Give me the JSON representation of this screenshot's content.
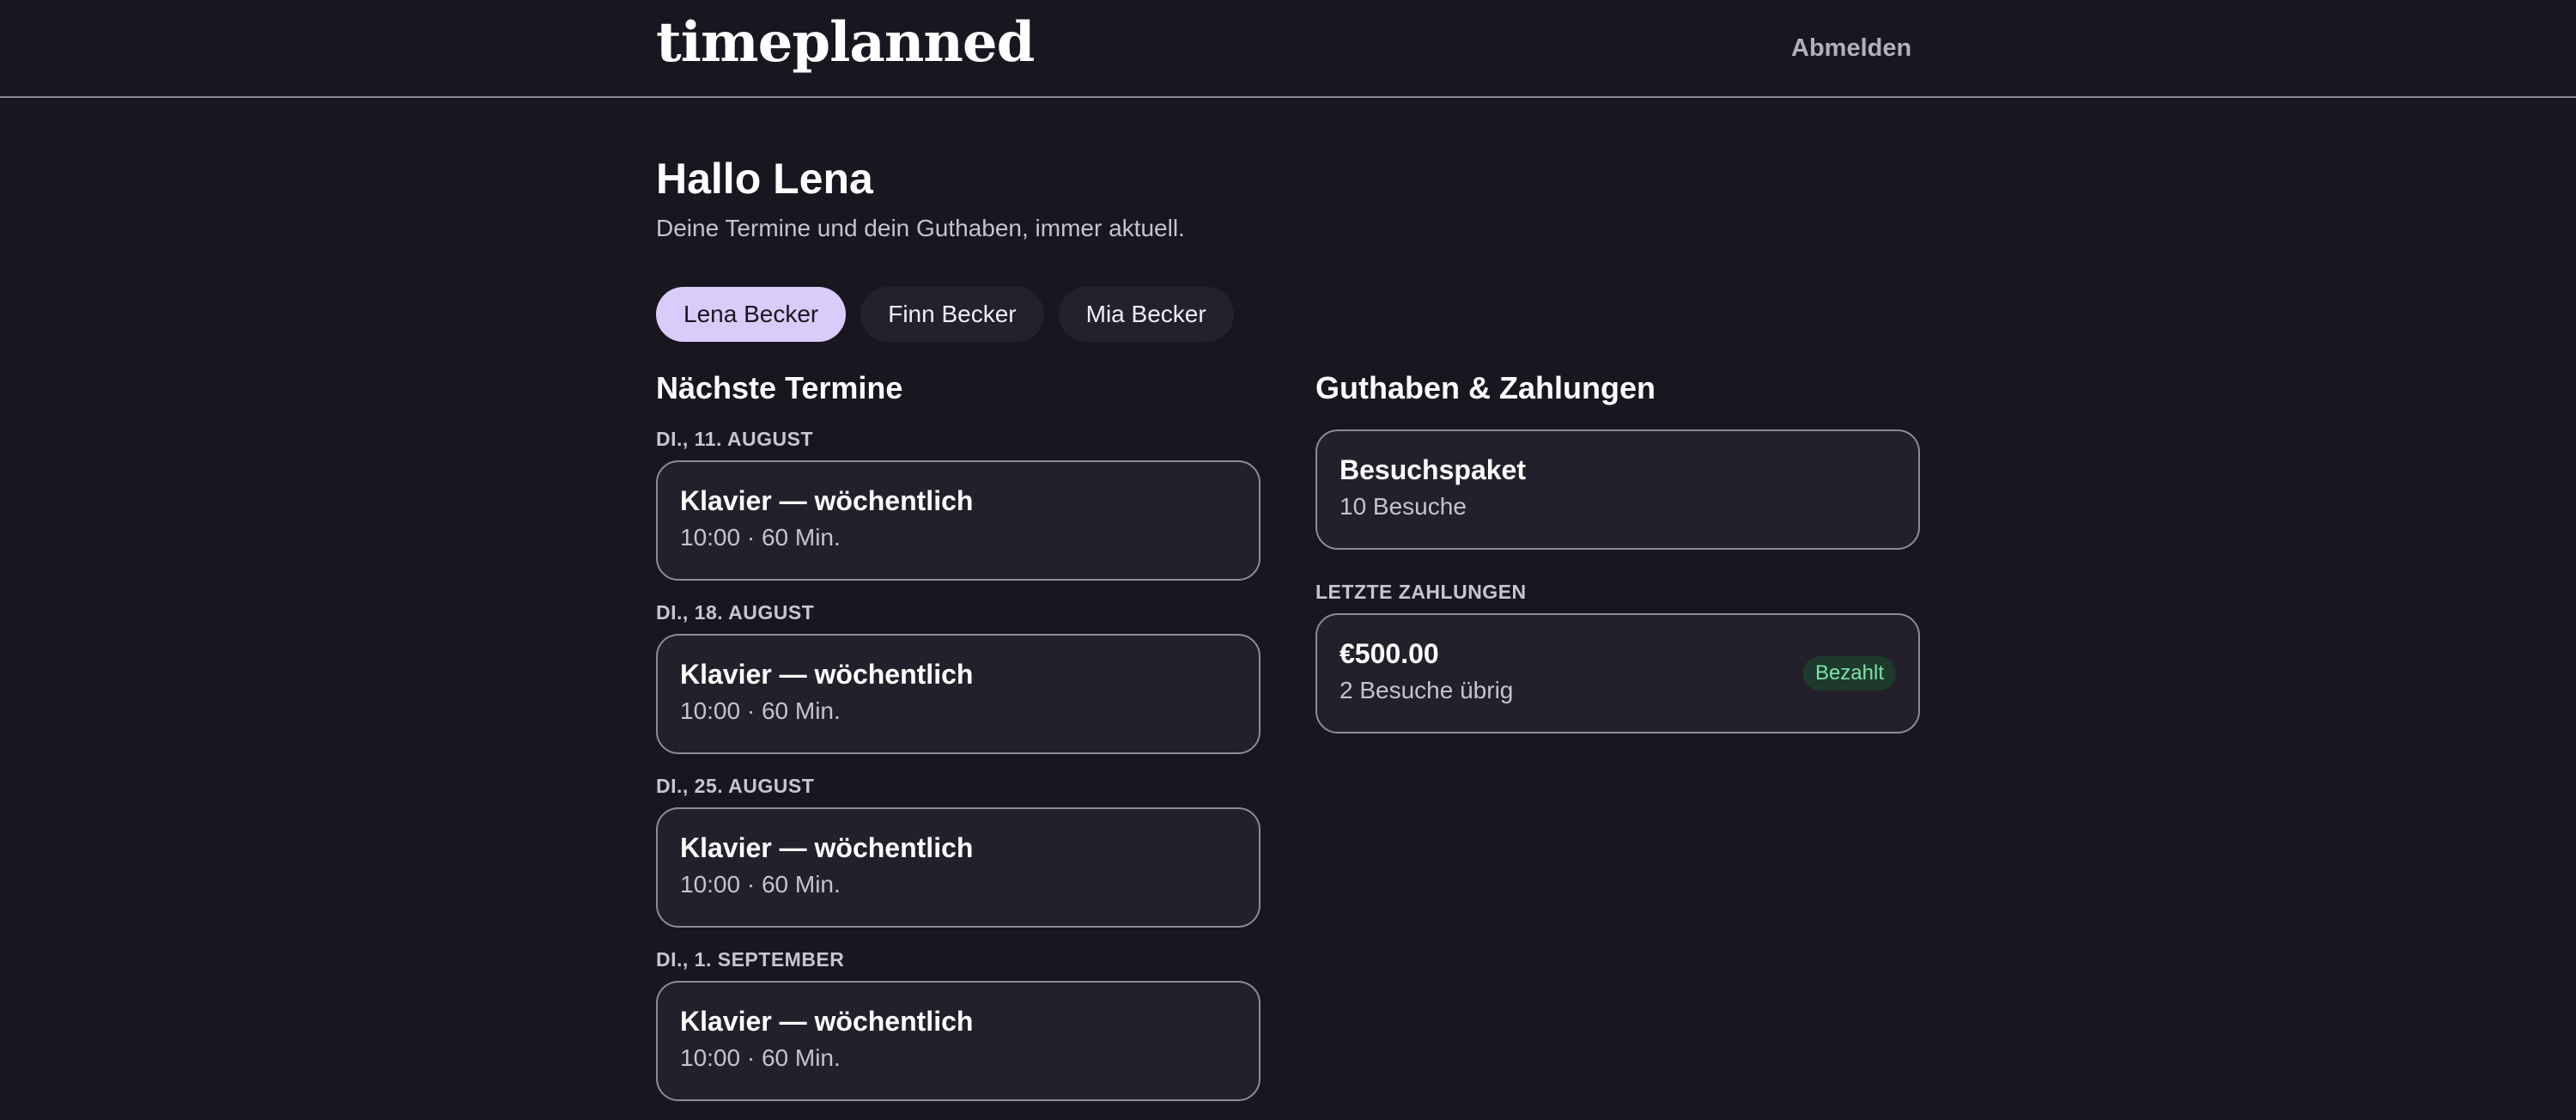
{
  "header": {
    "logo": "timeplanned",
    "logout_label": "Abmelden"
  },
  "greeting": "Hallo Lena",
  "subtitle": "Deine Termine und dein Guthaben, immer aktuell.",
  "person_tabs": [
    {
      "label": "Lena Becker",
      "active": true
    },
    {
      "label": "Finn Becker",
      "active": false
    },
    {
      "label": "Mia Becker",
      "active": false
    }
  ],
  "appointments_section": {
    "title": "Nächste Termine",
    "items": [
      {
        "date": "DI., 11. AUGUST",
        "title": "Klavier — wöchentlich",
        "details": "10:00 · 60 Min."
      },
      {
        "date": "DI., 18. AUGUST",
        "title": "Klavier — wöchentlich",
        "details": "10:00 · 60 Min."
      },
      {
        "date": "DI., 25. AUGUST",
        "title": "Klavier — wöchentlich",
        "details": "10:00 · 60 Min."
      },
      {
        "date": "DI., 1. SEPTEMBER",
        "title": "Klavier — wöchentlich",
        "details": "10:00 · 60 Min."
      }
    ]
  },
  "balance_section": {
    "title": "Guthaben & Zahlungen",
    "package": {
      "title": "Besuchspaket",
      "details": "10 Besuche"
    },
    "payments_label": "LETZTE ZAHLUNGEN",
    "payments": [
      {
        "amount": "€500.00",
        "details": "2 Besuche übrig",
        "status": "Bezahlt"
      }
    ]
  },
  "colors": {
    "background": "#1a1620",
    "card_background": "#24202b",
    "active_tab": "#d8ccfb",
    "badge_text": "#7ee2a8"
  }
}
